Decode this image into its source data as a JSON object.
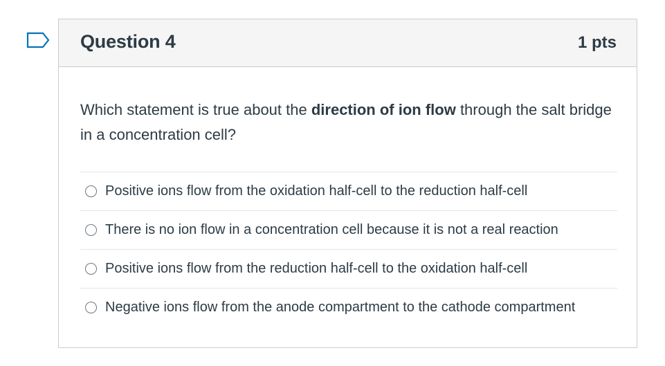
{
  "flag": {
    "icon": "bookmark-flag-icon",
    "color": "#0374b5"
  },
  "question": {
    "title": "Question 4",
    "points": "1 pts",
    "text_before": "Which statement is true about the ",
    "text_bold": "direction of ion flow",
    "text_after": " through the salt bridge in a concentration cell?"
  },
  "answers": [
    {
      "label": "Positive ions flow from the oxidation half-cell to the reduction half-cell",
      "selected": false
    },
    {
      "label": "There is no ion flow in a concentration cell because it is not a real reaction",
      "selected": false
    },
    {
      "label": "Positive ions flow from the reduction half-cell to the oxidation half-cell",
      "selected": false
    },
    {
      "label": "Negative ions flow from the anode compartment to the cathode compartment",
      "selected": false
    }
  ]
}
